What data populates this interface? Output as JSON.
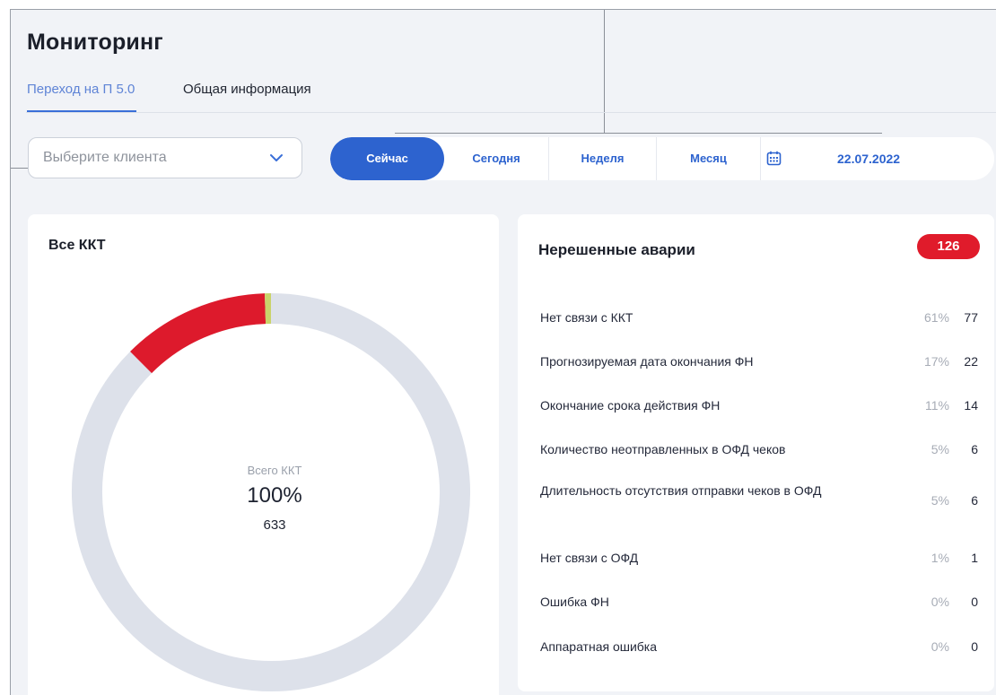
{
  "page": {
    "title": "Мониторинг"
  },
  "tabs": [
    {
      "label": "Переход на П 5.0",
      "active": true
    },
    {
      "label": "Общая информация",
      "active": false
    }
  ],
  "client_select": {
    "placeholder": "Выберите клиента",
    "icon": "chevron-down-icon"
  },
  "period": {
    "buttons": [
      {
        "label": "Сейчас",
        "active": true
      },
      {
        "label": "Сегодня",
        "active": false
      },
      {
        "label": "Неделя",
        "active": false
      },
      {
        "label": "Месяц",
        "active": false
      }
    ],
    "calendar_icon": "calendar-icon",
    "date": "22.07.2022"
  },
  "all_kkt": {
    "title": "Все ККТ",
    "center_label": "Всего ККТ",
    "percent": "100%",
    "total": "633",
    "donut_segments": [
      {
        "value": 0.875,
        "color": "#dde1ea"
      },
      {
        "value": 0.12,
        "color": "#dd1a2c"
      },
      {
        "value": 0.005,
        "color": "#c9d36b"
      }
    ]
  },
  "alarms": {
    "title": "Нерешенные аварии",
    "badge": "126",
    "accent_color": "#e01b2b",
    "items": [
      {
        "label": "Нет связи с ККТ",
        "percent": "61%",
        "count": "77"
      },
      {
        "label": "Прогнозируемая дата окончания ФН",
        "percent": "17%",
        "count": "22"
      },
      {
        "label": "Окончание срока действия ФН",
        "percent": "11%",
        "count": "14"
      },
      {
        "label": "Количество неотправленных в ОФД чеков",
        "percent": "5%",
        "count": "6"
      },
      {
        "label": "Длительность отсутствия отправки чеков в ОФД",
        "percent": "5%",
        "count": "6"
      },
      {
        "label": "Нет связи с ОФД",
        "percent": "1%",
        "count": "1"
      },
      {
        "label": "Ошибка ФН",
        "percent": "0%",
        "count": "0"
      },
      {
        "label": "Аппаратная ошибка",
        "percent": "0%",
        "count": "0"
      }
    ]
  }
}
